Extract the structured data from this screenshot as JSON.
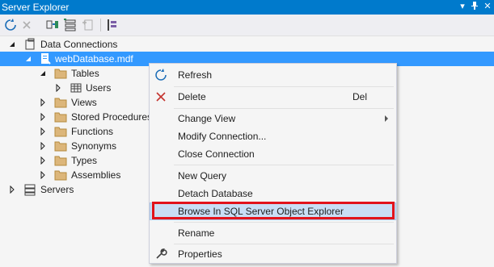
{
  "window": {
    "title": "Server Explorer",
    "colors": {
      "titlebar": "#007acc",
      "selection": "#3399ff",
      "highlight_box": "#e2131b"
    }
  },
  "titlebar_icons": [
    "dropdown-icon",
    "pin-icon",
    "close-icon"
  ],
  "toolbar": {
    "icons": [
      "refresh-icon",
      "stop-icon",
      "connect-to-database-icon",
      "connect-to-server-icon",
      "azure-connect-icon",
      "properties-icon"
    ]
  },
  "tree": {
    "data_connections": "Data Connections",
    "database": "webDatabase.mdf",
    "tables": "Tables",
    "users": "Users",
    "views": "Views",
    "stored_procedures": "Stored Procedures",
    "functions": "Functions",
    "synonyms": "Synonyms",
    "types": "Types",
    "assemblies": "Assemblies",
    "servers": "Servers"
  },
  "context_menu": {
    "refresh": "Refresh",
    "delete": "Delete",
    "delete_shortcut": "Del",
    "change_view": "Change View",
    "modify_connection": "Modify Connection...",
    "close_connection": "Close Connection",
    "new_query": "New Query",
    "detach_database": "Detach Database",
    "browse_sql": "Browse In SQL Server Object Explorer",
    "rename": "Rename",
    "properties": "Properties"
  }
}
